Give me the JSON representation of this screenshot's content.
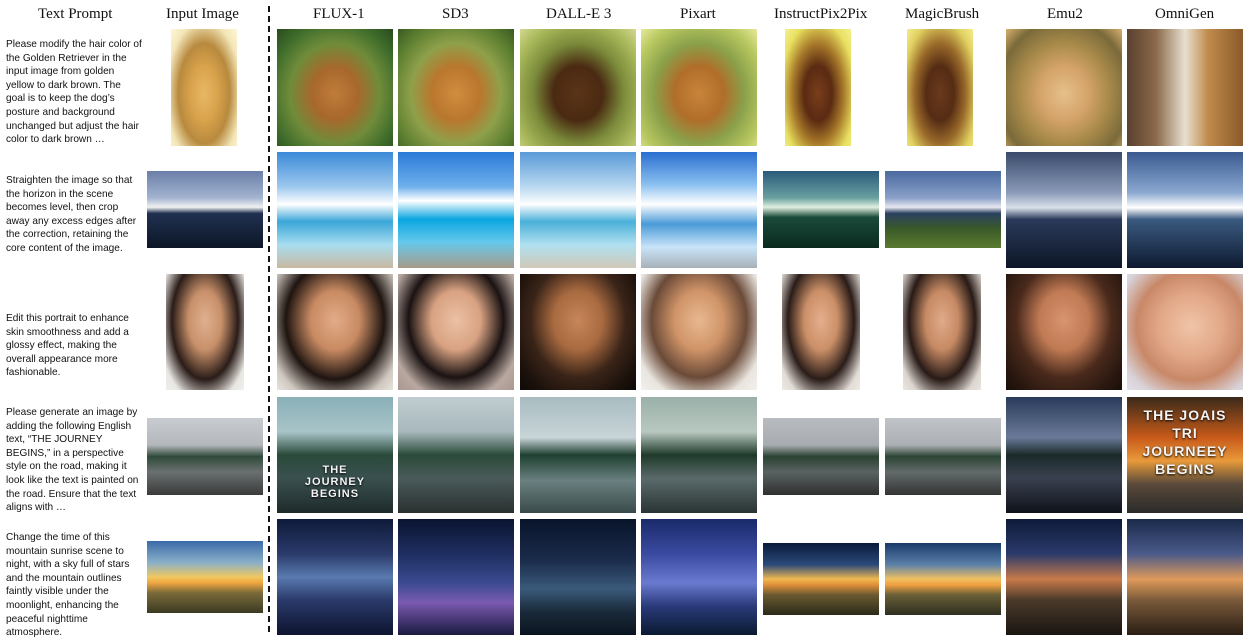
{
  "headers": [
    "Text Prompt",
    "Input Image",
    "FLUX-1",
    "SD3",
    "DALL-E 3",
    "Pixart",
    "InstructPix2Pix",
    "MagicBrush",
    "Emu2",
    "OmniGen"
  ],
  "prompts": [
    "Please modify the hair color of the Golden Retriever in the input image from golden yellow to dark brown. The goal is to keep the dog’s posture and background unchanged but adjust the hair color to dark brown …",
    "Straighten the image so that the horizon in the scene becomes level, then crop away any excess edges after the correction, retaining the core content of the image.",
    "Edit this portrait to enhance skin smoothness and add a glossy effect, making the overall appearance more fashionable.",
    "Please generate an image by adding the following English text, “THE JOURNEY BEGINS,” in a perspective style on the road, making it look like the text is painted on the road. Ensure that the text aligns with …",
    "Change the time of this mountain sunrise scene to night, with a sky full of stars and the mountain outlines faintly visible under the moonlight, enhancing the peaceful nighttime atmosphere."
  ],
  "text_in_images": {
    "flux_road": "THE JOURNEY BEGINS",
    "omnigen_road": "THE JOAIS TRI JOURNEEY BEGINS"
  },
  "colors": {
    "dog_golden": "#d9a24c",
    "dog_brown": "#6a3a1c",
    "sky_blue": "#4aa3e0",
    "skin": "#d9a48a",
    "forest": "#2f4a3a",
    "night": "#1b2a5a",
    "sunrise": "#f0a640"
  }
}
